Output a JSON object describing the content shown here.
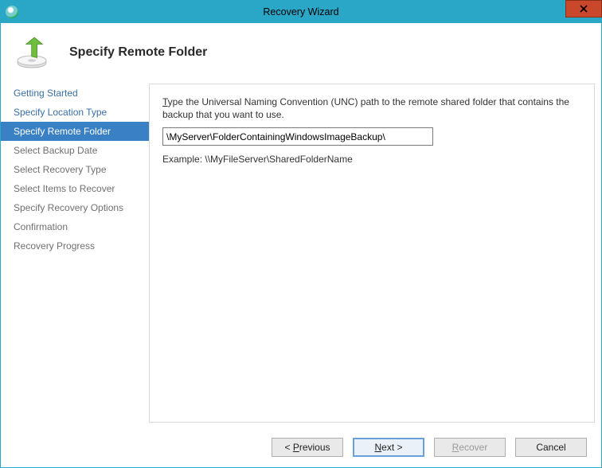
{
  "window": {
    "title": "Recovery Wizard"
  },
  "header": {
    "heading": "Specify Remote Folder"
  },
  "sidebar": {
    "items": [
      {
        "label": "Getting Started",
        "state": "done"
      },
      {
        "label": "Specify Location Type",
        "state": "done"
      },
      {
        "label": "Specify Remote Folder",
        "state": "current"
      },
      {
        "label": "Select Backup Date",
        "state": "pending"
      },
      {
        "label": "Select Recovery Type",
        "state": "pending"
      },
      {
        "label": "Select Items to Recover",
        "state": "pending"
      },
      {
        "label": "Specify Recovery Options",
        "state": "pending"
      },
      {
        "label": "Confirmation",
        "state": "pending"
      },
      {
        "label": "Recovery Progress",
        "state": "pending"
      }
    ]
  },
  "content": {
    "instruction_before_underline": "",
    "instruction_underline": "T",
    "instruction_after_underline": "ype the Universal Naming Convention (UNC) path to the remote shared folder that contains the backup that you want to use.",
    "path_value": "\\MyServer\\FolderContainingWindowsImageBackup\\",
    "example": "Example: \\\\MyFileServer\\SharedFolderName"
  },
  "footer": {
    "previous_pre": "< ",
    "previous_u": "P",
    "previous_post": "revious",
    "next_u": "N",
    "next_post": "ext >",
    "recover_u": "R",
    "recover_post": "ecover",
    "cancel": "Cancel"
  }
}
